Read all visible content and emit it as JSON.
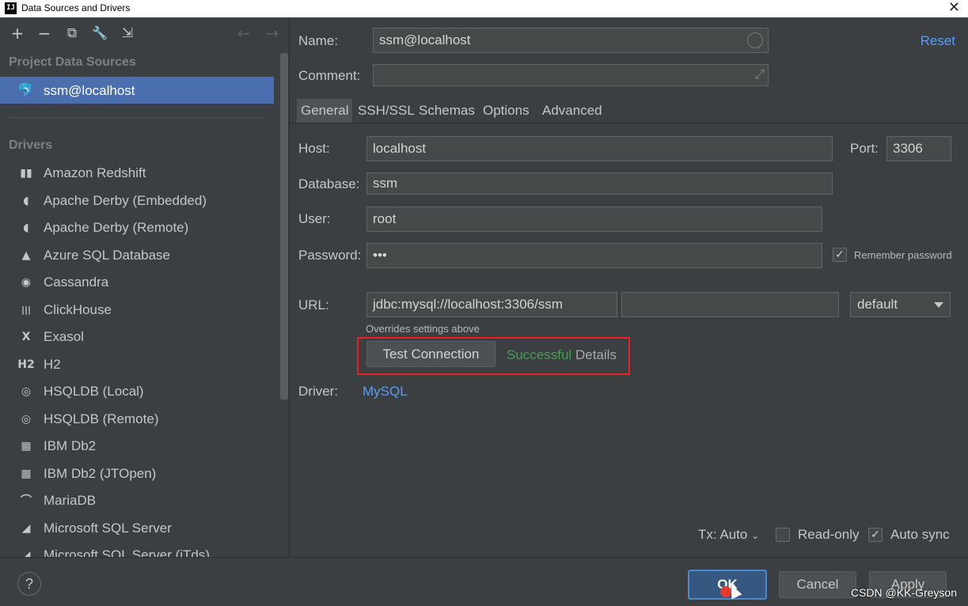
{
  "window": {
    "title": "Data Sources and Drivers",
    "app_icon": "IJ"
  },
  "toolbar": {
    "add": "+",
    "remove": "−",
    "copy": "⧉",
    "settings": "🔧",
    "import": "⇲",
    "back": "←",
    "forward": "→"
  },
  "sidebar": {
    "project_header": "Project Data Sources",
    "selected_source": "ssm@localhost",
    "drivers_header": "Drivers",
    "drivers": [
      {
        "label": "Amazon Redshift",
        "icon": "redshift-icon",
        "glyph": "▮▮"
      },
      {
        "label": "Apache Derby (Embedded)",
        "icon": "derby-icon",
        "glyph": "◖"
      },
      {
        "label": "Apache Derby (Remote)",
        "icon": "derby-icon",
        "glyph": "◖"
      },
      {
        "label": "Azure SQL Database",
        "icon": "azure-icon",
        "glyph": "▲"
      },
      {
        "label": "Cassandra",
        "icon": "cassandra-icon",
        "glyph": "◉"
      },
      {
        "label": "ClickHouse",
        "icon": "clickhouse-icon",
        "glyph": "|||"
      },
      {
        "label": "Exasol",
        "icon": "exasol-icon",
        "glyph": "X"
      },
      {
        "label": "H2",
        "icon": "h2-icon",
        "glyph": "H2"
      },
      {
        "label": "HSQLDB (Local)",
        "icon": "hsqldb-icon",
        "glyph": "◎"
      },
      {
        "label": "HSQLDB (Remote)",
        "icon": "hsqldb-icon",
        "glyph": "◎"
      },
      {
        "label": "IBM Db2",
        "icon": "ibm-db2-icon",
        "glyph": "▦"
      },
      {
        "label": "IBM Db2 (JTOpen)",
        "icon": "ibm-db2-icon",
        "glyph": "▦"
      },
      {
        "label": "MariaDB",
        "icon": "mariadb-icon",
        "glyph": "⌒"
      },
      {
        "label": "Microsoft SQL Server",
        "icon": "mssql-icon",
        "glyph": "◢"
      },
      {
        "label": "Microsoft SQL Server (jTds)",
        "icon": "mssql-icon",
        "glyph": "◢"
      }
    ]
  },
  "form": {
    "name_label": "Name:",
    "name_value": "ssm@localhost",
    "reset_label": "Reset",
    "comment_label": "Comment:",
    "comment_value": "",
    "tabs": [
      "General",
      "SSH/SSL",
      "Schemas",
      "Options",
      "Advanced"
    ],
    "active_tab": "General",
    "host_label": "Host:",
    "host_value": "localhost",
    "port_label": "Port:",
    "port_value": "3306",
    "database_label": "Database:",
    "database_value": "ssm",
    "user_label": "User:",
    "user_value": "root",
    "password_label": "Password:",
    "password_value": "•••",
    "remember_password_label": "Remember password",
    "remember_password_checked": true,
    "url_label": "URL:",
    "url_value": "jdbc:mysql://localhost:3306/ssm",
    "url_extra_value": "",
    "url_mode": "default",
    "overrides_note": "Overrides settings above",
    "test_connection_label": "Test Connection",
    "test_status": "Successful",
    "details_label": "Details",
    "driver_label": "Driver:",
    "driver_value": "MySQL",
    "tx_label": "Tx: Auto",
    "read_only_label": "Read-only",
    "read_only_checked": false,
    "auto_sync_label": "Auto sync",
    "auto_sync_checked": true
  },
  "footer": {
    "help_label": "?",
    "ok_label": "OK",
    "cancel_label": "Cancel",
    "apply_label": "Apply",
    "watermark": "CSDN @KK-Greyson"
  },
  "colors": {
    "selection": "#4b6eaf",
    "link": "#589df6",
    "success": "#499c54",
    "highlight_box": "#e8202a"
  }
}
